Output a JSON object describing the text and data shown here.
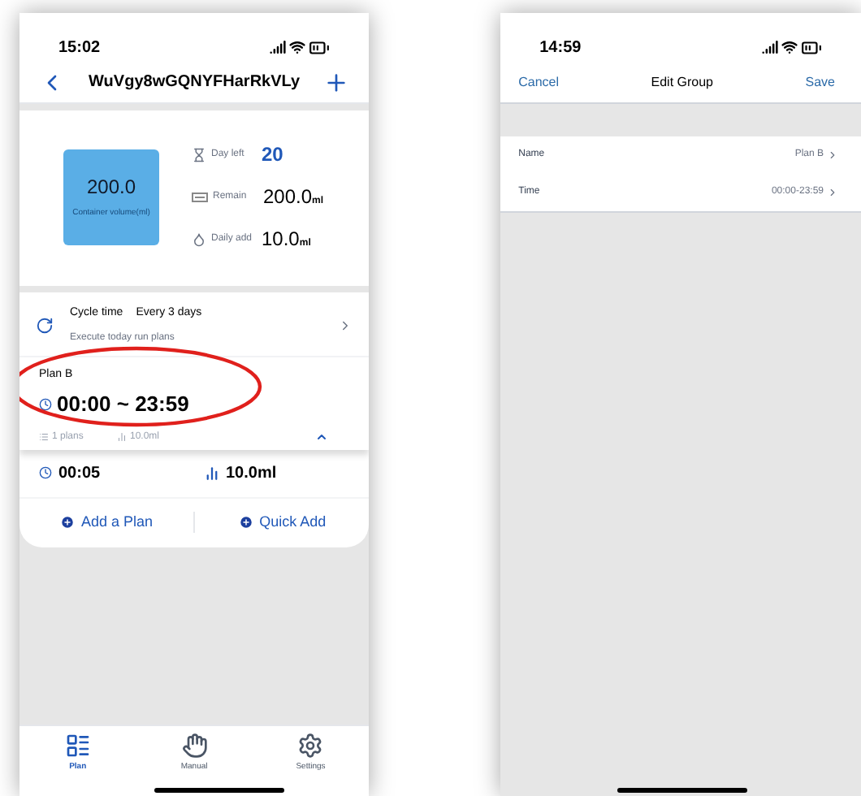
{
  "left_screen": {
    "status_time": "15:02",
    "title": "WuVgy8wGQNYFHarRkVLy",
    "container": {
      "value": "200.0",
      "label": "Container volume(ml)"
    },
    "stats": [
      {
        "kind": "days",
        "label": "Day left",
        "value": "20"
      },
      {
        "kind": "remain",
        "label": "Remain",
        "value": "200.0",
        "unit": "ml"
      },
      {
        "kind": "daily",
        "label": "Daily add",
        "value": "10.0",
        "unit": "ml"
      }
    ],
    "cycle": {
      "label": "Cycle time",
      "value": "Every 3 days",
      "subtitle": "Execute today run plans"
    },
    "plan": {
      "name": "Plan B",
      "time_range": "00:00 ~ 23:59",
      "count": "1 plans",
      "amount": "10.0ml",
      "expanded": true,
      "highlighted": true
    },
    "entries": [
      {
        "time": "00:05",
        "amount": "10.0ml"
      }
    ],
    "actions": [
      "Add a Plan",
      "Quick Add"
    ],
    "tabs": [
      {
        "kind": "plan",
        "label": "Plan",
        "selected": true
      },
      {
        "kind": "manual",
        "label": "Manual",
        "selected": false
      },
      {
        "kind": "settings",
        "label": "Settings",
        "selected": false
      }
    ]
  },
  "right_screen": {
    "status_time": "14:59",
    "cancel": "Cancel",
    "title": "Edit Group",
    "save": "Save",
    "rows": [
      {
        "label": "Name",
        "value": "Plan B"
      },
      {
        "label": "Time",
        "value": "00:00-23:59"
      }
    ]
  }
}
